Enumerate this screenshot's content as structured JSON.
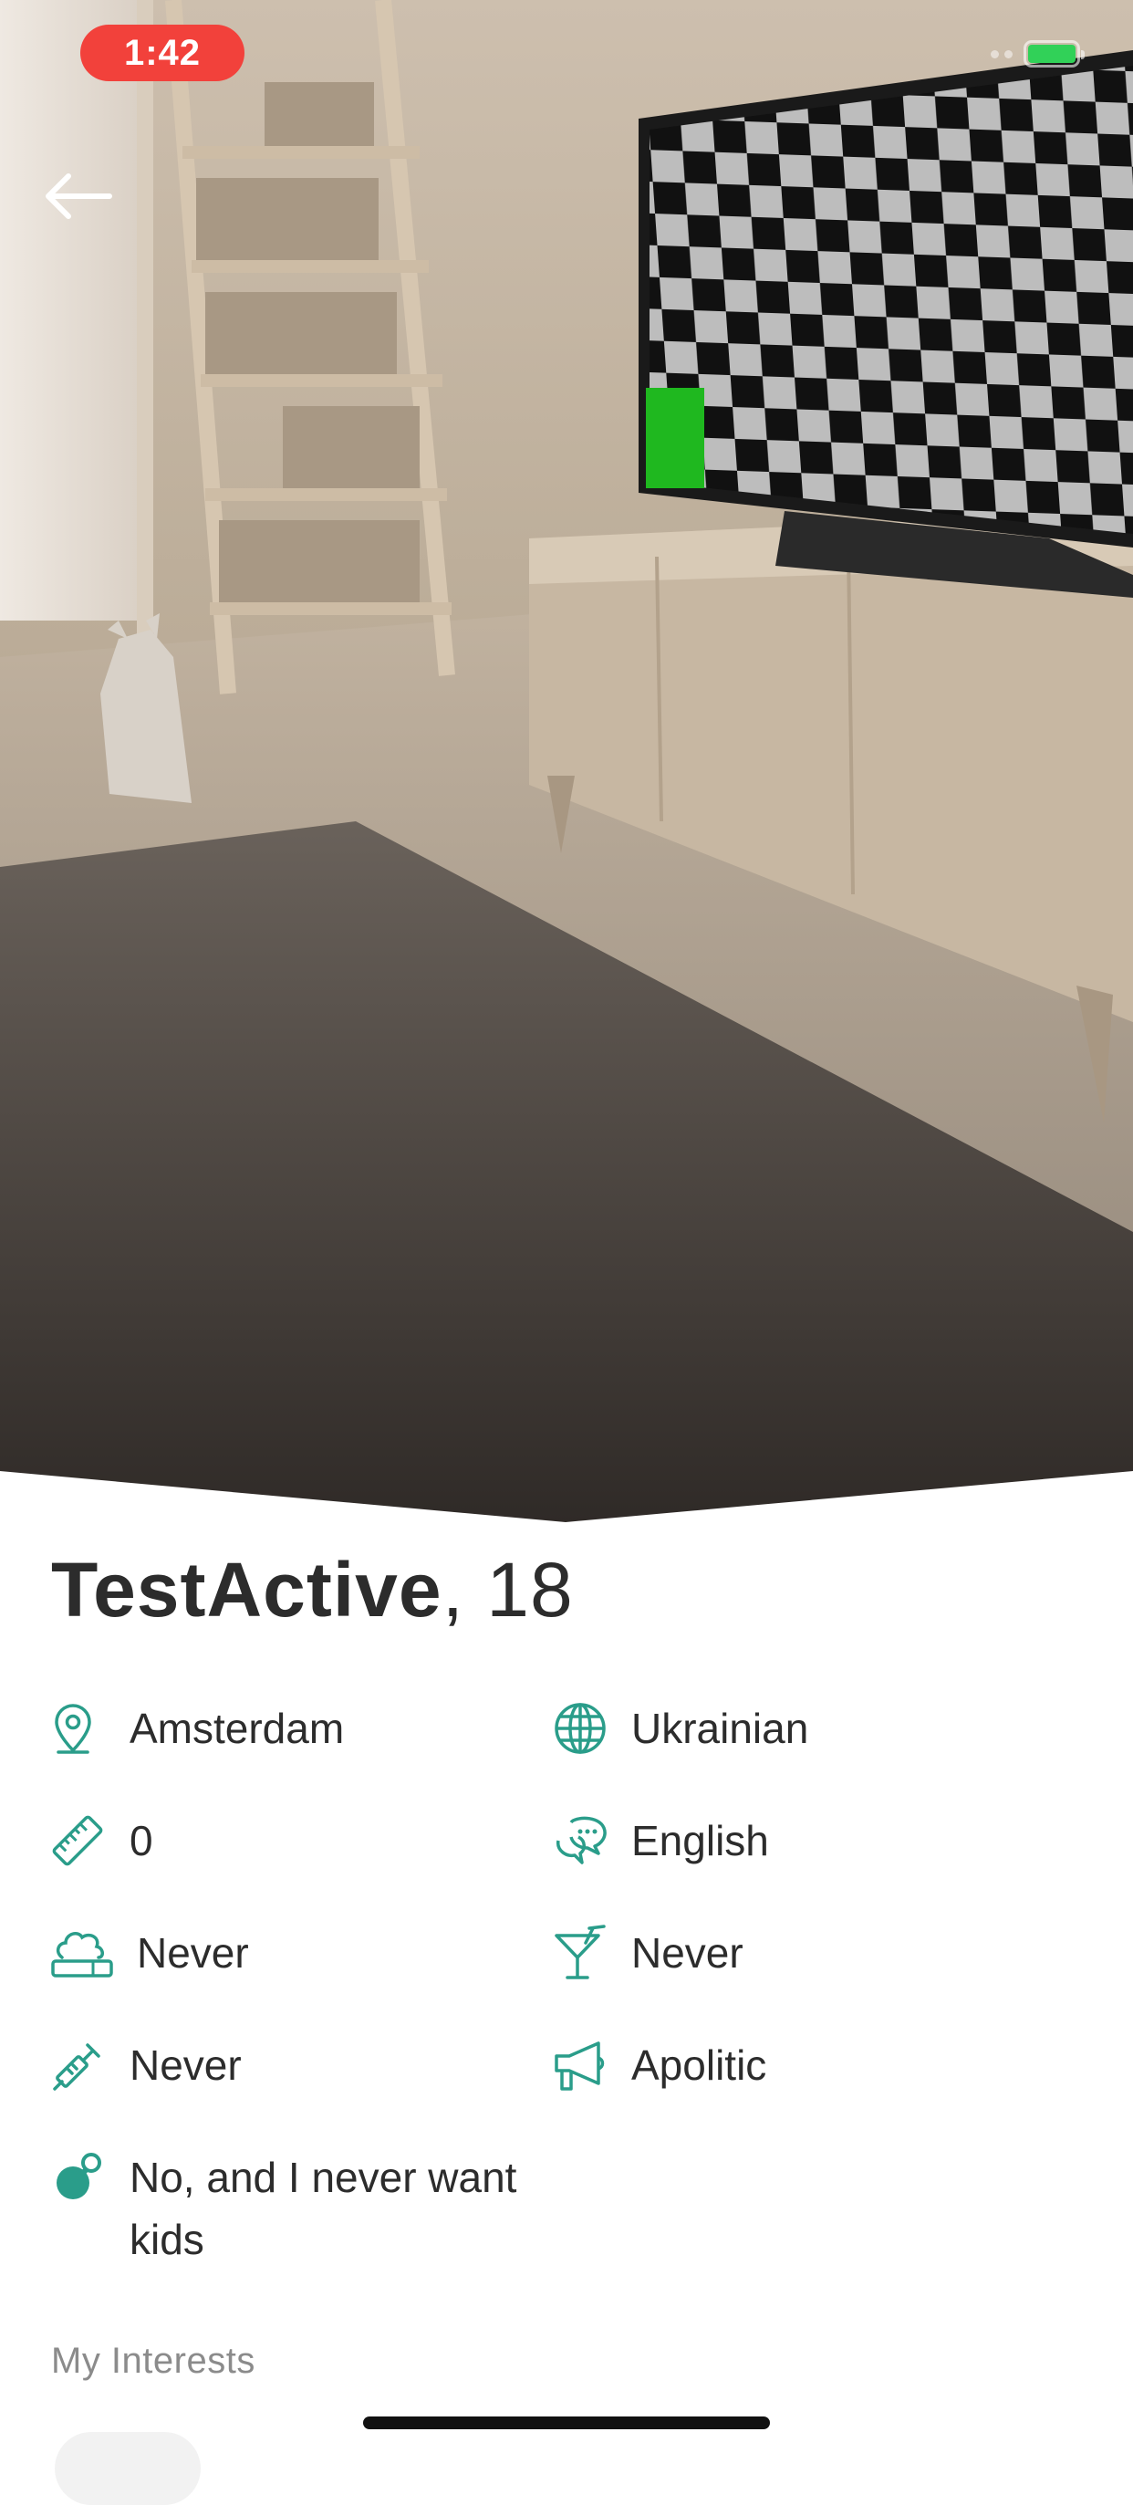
{
  "status_bar": {
    "time": "1:42"
  },
  "profile": {
    "name": "TestActive",
    "age_text": ", 18"
  },
  "attributes": {
    "location": {
      "icon": "location-pin-icon",
      "value": "Amsterdam"
    },
    "nationality": {
      "icon": "globe-icon",
      "value": "Ukrainian"
    },
    "height": {
      "icon": "ruler-icon",
      "value": "0"
    },
    "language": {
      "icon": "chat-bubbles-icon",
      "value": "English"
    },
    "smoking": {
      "icon": "smoking-icon",
      "value": "Never"
    },
    "drinking": {
      "icon": "cocktail-icon",
      "value": "Never"
    },
    "drugs": {
      "icon": "syringe-icon",
      "value": "Never"
    },
    "politics": {
      "icon": "megaphone-icon",
      "value": "Apolitic"
    },
    "kids": {
      "icon": "pacifier-icon",
      "value": "No, and I never want kids"
    }
  },
  "interests": {
    "title": "My Interests"
  },
  "colors": {
    "accent": "#2a9d8a",
    "status_pill": "#f2413b",
    "text": "#2c2c2c",
    "muted": "#8b8b8b"
  }
}
